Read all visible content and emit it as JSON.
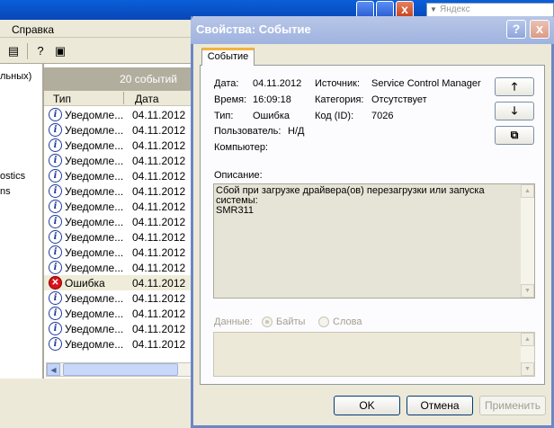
{
  "background_window": {
    "search_placeholder": "Яндекс",
    "close_glyph": "x",
    "menu": {
      "help": "Справка"
    },
    "tree_items": [
      "льных)",
      "ostics",
      "ns"
    ],
    "list": {
      "events_count": "20 событий",
      "columns": {
        "type": "Тип",
        "date": "Дата"
      },
      "rows": [
        {
          "type": "Уведомле...",
          "date": "04.11.2012",
          "kind": "info"
        },
        {
          "type": "Уведомле...",
          "date": "04.11.2012",
          "kind": "info"
        },
        {
          "type": "Уведомле...",
          "date": "04.11.2012",
          "kind": "info"
        },
        {
          "type": "Уведомле...",
          "date": "04.11.2012",
          "kind": "info"
        },
        {
          "type": "Уведомле...",
          "date": "04.11.2012",
          "kind": "info"
        },
        {
          "type": "Уведомле...",
          "date": "04.11.2012",
          "kind": "info"
        },
        {
          "type": "Уведомле...",
          "date": "04.11.2012",
          "kind": "info"
        },
        {
          "type": "Уведомле...",
          "date": "04.11.2012",
          "kind": "info"
        },
        {
          "type": "Уведомле...",
          "date": "04.11.2012",
          "kind": "info"
        },
        {
          "type": "Уведомле...",
          "date": "04.11.2012",
          "kind": "info"
        },
        {
          "type": "Уведомле...",
          "date": "04.11.2012",
          "kind": "info"
        },
        {
          "type": "Ошибка",
          "date": "04.11.2012",
          "kind": "error"
        },
        {
          "type": "Уведомле...",
          "date": "04.11.2012",
          "kind": "info"
        },
        {
          "type": "Уведомле...",
          "date": "04.11.2012",
          "kind": "info"
        },
        {
          "type": "Уведомле...",
          "date": "04.11.2012",
          "kind": "info"
        },
        {
          "type": "Уведомле...",
          "date": "04.11.2012",
          "kind": "info"
        }
      ]
    }
  },
  "dialog": {
    "title": "Свойства: Событие",
    "help_glyph": "?",
    "close_glyph": "x",
    "tab": "Событие",
    "fields": {
      "date_label": "Дата:",
      "date_value": "04.11.2012",
      "time_label": "Время:",
      "time_value": "16:09:18",
      "type_label": "Тип:",
      "type_value": "Ошибка",
      "user_label": "Пользователь:",
      "user_value": "Н/Д",
      "computer_label": "Компьютер:",
      "source_label": "Источник:",
      "source_value": "Service Control Manager",
      "category_label": "Категория:",
      "category_value": "Отсутствует",
      "code_label": "Код (ID):",
      "code_value": "7026"
    },
    "description_label": "Описание:",
    "description_text": "Сбой при загрузке драйвера(ов) перезагрузки или запуска системы:",
    "description_driver": "SMR311",
    "data_label": "Данные:",
    "data_options": {
      "bytes": "Байты",
      "words": "Слова"
    },
    "buttons": {
      "ok": "OK",
      "cancel": "Отмена",
      "apply": "Применить"
    }
  }
}
